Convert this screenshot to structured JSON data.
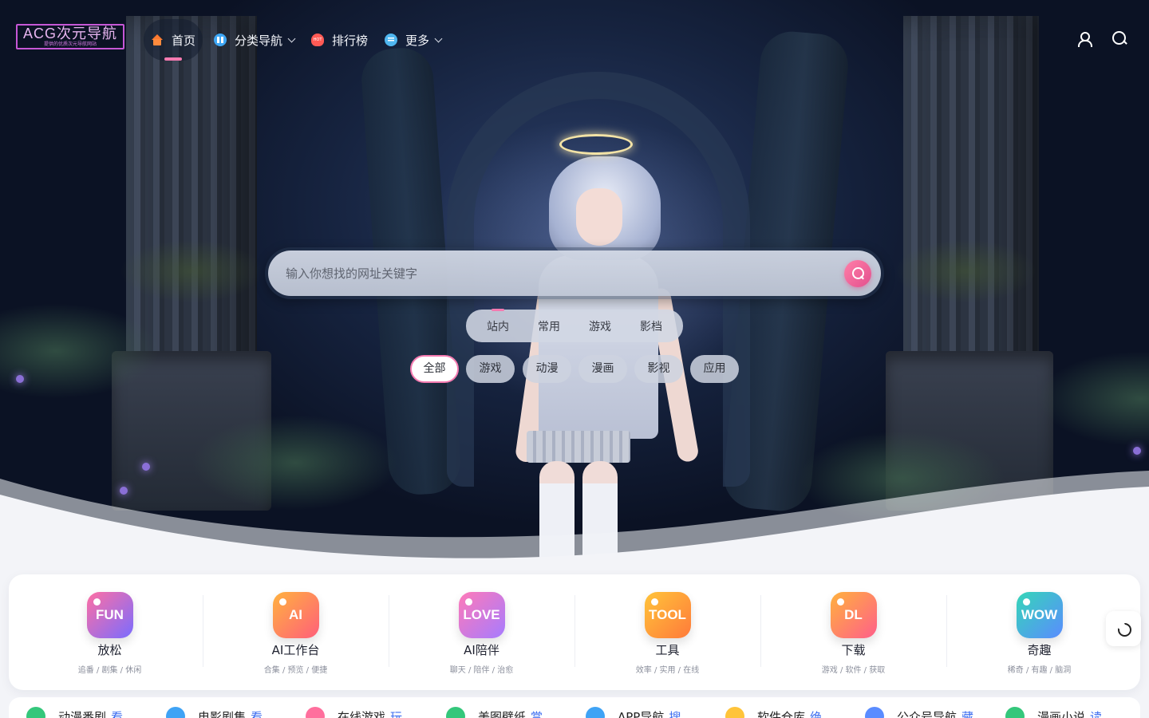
{
  "nav": {
    "logo_title": "ACG次元导航",
    "logo_subtitle": "提供的优质次元导航网站",
    "items": [
      {
        "label": "首页",
        "icon": "home-icon",
        "active": true
      },
      {
        "label": "分类导航",
        "icon": "grid-icon",
        "has_dropdown": true
      },
      {
        "label": "排行榜",
        "icon": "hot-fire-icon"
      },
      {
        "label": "更多",
        "icon": "menu-icon",
        "has_dropdown": true
      }
    ],
    "right_icons": [
      "user-icon",
      "search-icon"
    ]
  },
  "search": {
    "placeholder": "输入你想找的网址关键字",
    "scope_tabs": [
      "站内",
      "常用",
      "游戏",
      "影档"
    ],
    "active_scope": "站内",
    "categories": [
      "全部",
      "游戏",
      "动漫",
      "漫画",
      "影视",
      "应用"
    ],
    "active_category": "全部"
  },
  "features": [
    {
      "badge": "FUN",
      "title": "放松",
      "subtitle": "追番 / 剧集 / 休闲",
      "color_from": "#ff6fa3",
      "color_to": "#7a6cff"
    },
    {
      "badge": "AI",
      "title": "AI工作台",
      "subtitle": "合集 / 预览 / 便捷",
      "color_from": "#ffb23f",
      "color_to": "#ff5f7a"
    },
    {
      "badge": "LOVE",
      "title": "AI陪伴",
      "subtitle": "聊天 / 陪伴 / 治愈",
      "color_from": "#ff7ab8",
      "color_to": "#a67bff"
    },
    {
      "badge": "TOOL",
      "title": "工具",
      "subtitle": "效率 / 实用 / 在线",
      "color_from": "#ffc43a",
      "color_to": "#ff7a3a"
    },
    {
      "badge": "DL",
      "title": "下载",
      "subtitle": "游戏 / 软件 / 获取",
      "color_from": "#ffb13d",
      "color_to": "#ff5f8a"
    },
    {
      "badge": "WOW",
      "title": "奇趣",
      "subtitle": "稀奇 / 有趣 / 脑洞",
      "color_from": "#35d6b8",
      "color_to": "#5a8cff"
    }
  ],
  "quick_links": [
    {
      "label": "动漫番剧",
      "tag": "看",
      "color": "#34c77b"
    },
    {
      "label": "电影剧集",
      "tag": "看",
      "color": "#3fa3f5"
    },
    {
      "label": "在线游戏",
      "tag": "玩",
      "color": "#ff6f9d"
    },
    {
      "label": "美图壁纸",
      "tag": "赏",
      "color": "#34c77b"
    },
    {
      "label": "APP导航",
      "tag": "搜",
      "color": "#3fa3f5"
    },
    {
      "label": "软件仓库",
      "tag": "绝",
      "color": "#ffc43a"
    },
    {
      "label": "公众号导航",
      "tag": "藏",
      "color": "#5a8cff"
    },
    {
      "label": "漫画小说",
      "tag": "读",
      "color": "#34c77b"
    }
  ],
  "accent_color": "#f47ab0"
}
